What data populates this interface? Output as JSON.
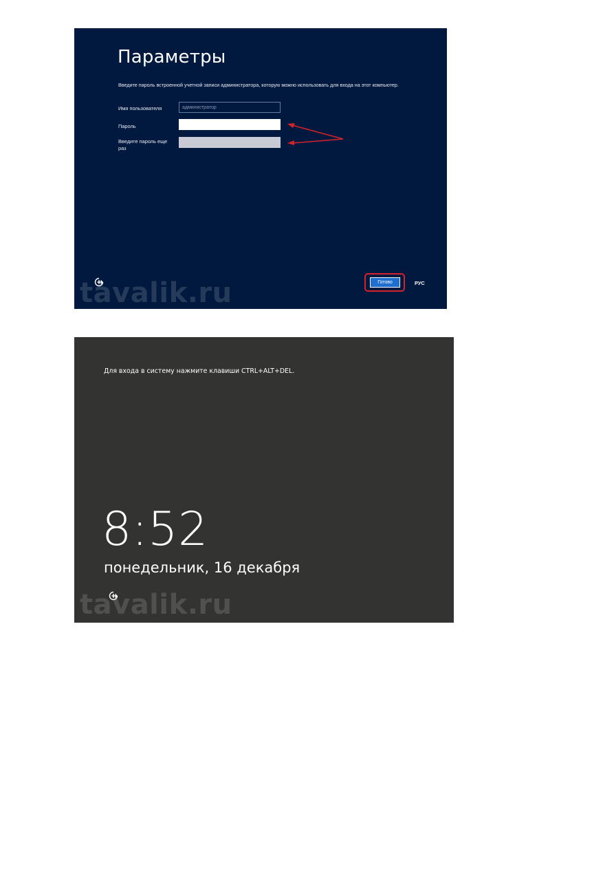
{
  "settings_screen": {
    "title": "Параметры",
    "description": "Введите пароль встроенной учетной записи администратора, которую можно использовать для входа на этот компьютер.",
    "username_label": "Имя пользователя",
    "username_value": "администратор",
    "password_label": "Пароль",
    "password_value": "",
    "confirm_password_label": "Введите пароль еще раз",
    "confirm_password_value": "",
    "done_button_label": "Готово",
    "language_indicator": "РУС",
    "watermark": "tavalik.ru",
    "icons": {
      "ease_of_access": "ease-of-access-icon"
    },
    "colors": {
      "background": "#02193f",
      "button": "#1f6fd1",
      "annotation": "#d6232a"
    }
  },
  "lock_screen": {
    "hint": "Для входа в систему нажмите клавиши CTRL+ALT+DEL.",
    "time": "8:52",
    "date": "понедельник, 16 декабря",
    "watermark": "tavalik.ru",
    "icons": {
      "ease_of_access": "ease-of-access-icon"
    },
    "colors": {
      "background": "#333431"
    }
  }
}
